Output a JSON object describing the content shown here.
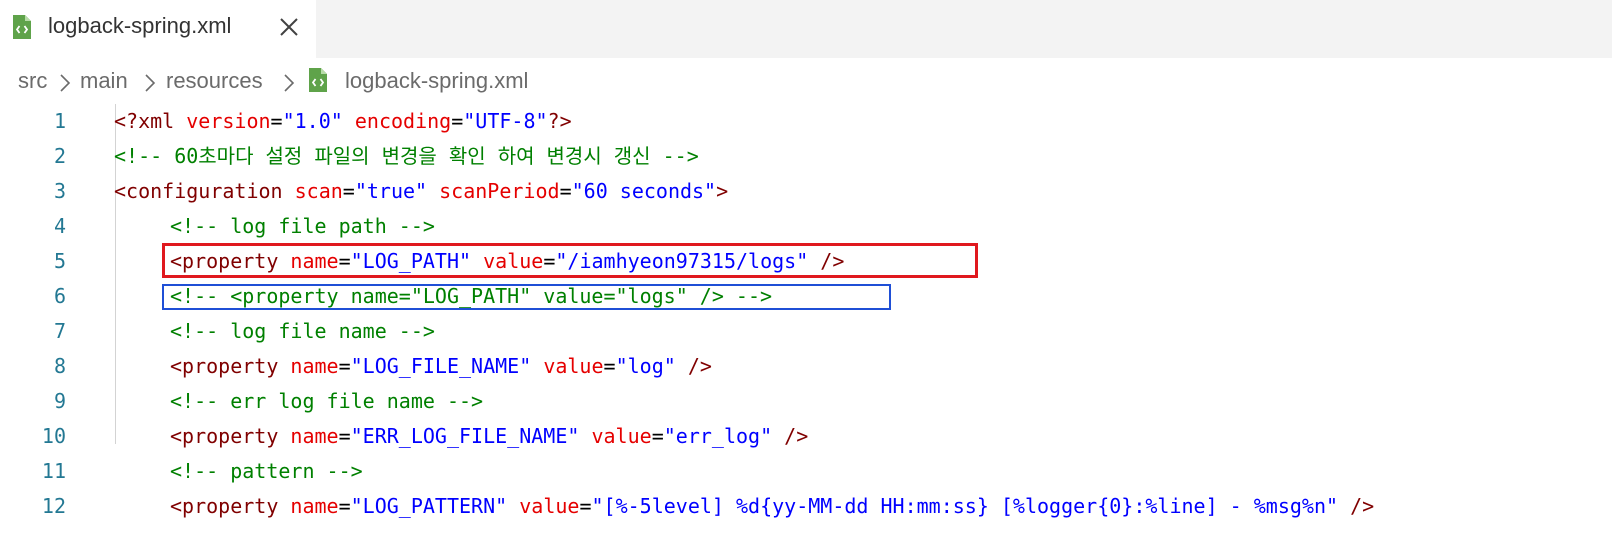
{
  "tab": {
    "label": "logback-spring.xml",
    "file_icon": "xml-file-icon",
    "close_icon": "close-icon"
  },
  "breadcrumb": {
    "items": [
      "src",
      "main",
      "resources",
      "logback-spring.xml"
    ],
    "separator": ">"
  },
  "editor": {
    "lines": [
      {
        "n": "1",
        "tokens": [
          {
            "c": "t-tag",
            "t": "<?xml "
          },
          {
            "c": "t-attr",
            "t": "version"
          },
          {
            "c": "t-eq",
            "t": "="
          },
          {
            "c": "t-val",
            "t": "\"1.0\""
          },
          {
            "c": "t-eq",
            "t": " "
          },
          {
            "c": "t-attr",
            "t": "encoding"
          },
          {
            "c": "t-eq",
            "t": "="
          },
          {
            "c": "t-val",
            "t": "\"UTF-8\""
          },
          {
            "c": "t-tag",
            "t": "?>"
          }
        ]
      },
      {
        "n": "2",
        "tokens": [
          {
            "c": "t-com",
            "t": "<!-- 60초마다 설정 파일의 변경을 확인 하여 변경시 갱신 -->"
          }
        ]
      },
      {
        "n": "3",
        "tokens": [
          {
            "c": "t-tag",
            "t": "<configuration "
          },
          {
            "c": "t-attr",
            "t": "scan"
          },
          {
            "c": "t-eq",
            "t": "="
          },
          {
            "c": "t-val",
            "t": "\"true\""
          },
          {
            "c": "t-eq",
            "t": " "
          },
          {
            "c": "t-attr",
            "t": "scanPeriod"
          },
          {
            "c": "t-eq",
            "t": "="
          },
          {
            "c": "t-val",
            "t": "\"60 seconds\""
          },
          {
            "c": "t-tag",
            "t": ">"
          }
        ]
      },
      {
        "n": "4",
        "indent": 1,
        "tokens": [
          {
            "c": "t-com",
            "t": "<!-- log file path -->"
          }
        ]
      },
      {
        "n": "5",
        "indent": 1,
        "tokens": [
          {
            "c": "t-tag",
            "t": "<property "
          },
          {
            "c": "t-attr",
            "t": "name"
          },
          {
            "c": "t-eq",
            "t": "="
          },
          {
            "c": "t-val",
            "t": "\"LOG_PATH\""
          },
          {
            "c": "t-eq",
            "t": " "
          },
          {
            "c": "t-attr",
            "t": "value"
          },
          {
            "c": "t-eq",
            "t": "="
          },
          {
            "c": "t-val",
            "t": "\"/iamhyeon97315/logs\""
          },
          {
            "c": "t-tag",
            "t": " />"
          }
        ]
      },
      {
        "n": "6",
        "indent": 1,
        "tokens": [
          {
            "c": "t-com",
            "t": "<!-- <property name=\"LOG_PATH\" value=\"logs\" /> -->"
          }
        ]
      },
      {
        "n": "7",
        "indent": 1,
        "tokens": [
          {
            "c": "t-com",
            "t": "<!-- log file name -->"
          }
        ]
      },
      {
        "n": "8",
        "indent": 1,
        "tokens": [
          {
            "c": "t-tag",
            "t": "<property "
          },
          {
            "c": "t-attr",
            "t": "name"
          },
          {
            "c": "t-eq",
            "t": "="
          },
          {
            "c": "t-val",
            "t": "\"LOG_FILE_NAME\""
          },
          {
            "c": "t-eq",
            "t": " "
          },
          {
            "c": "t-attr",
            "t": "value"
          },
          {
            "c": "t-eq",
            "t": "="
          },
          {
            "c": "t-val",
            "t": "\"log\""
          },
          {
            "c": "t-tag",
            "t": " />"
          }
        ]
      },
      {
        "n": "9",
        "indent": 1,
        "tokens": [
          {
            "c": "t-com",
            "t": "<!-- err log file name -->"
          }
        ]
      },
      {
        "n": "10",
        "indent": 1,
        "tokens": [
          {
            "c": "t-tag",
            "t": "<property "
          },
          {
            "c": "t-attr",
            "t": "name"
          },
          {
            "c": "t-eq",
            "t": "="
          },
          {
            "c": "t-val",
            "t": "\"ERR_LOG_FILE_NAME\""
          },
          {
            "c": "t-eq",
            "t": " "
          },
          {
            "c": "t-attr",
            "t": "value"
          },
          {
            "c": "t-eq",
            "t": "="
          },
          {
            "c": "t-val",
            "t": "\"err_log\""
          },
          {
            "c": "t-tag",
            "t": " />"
          }
        ]
      },
      {
        "n": "11",
        "indent": 1,
        "tokens": [
          {
            "c": "t-com",
            "t": "<!-- pattern -->"
          }
        ]
      },
      {
        "n": "12",
        "indent": 1,
        "tokens": [
          {
            "c": "t-tag",
            "t": "<property "
          },
          {
            "c": "t-attr",
            "t": "name"
          },
          {
            "c": "t-eq",
            "t": "="
          },
          {
            "c": "t-val",
            "t": "\"LOG_PATTERN\""
          },
          {
            "c": "t-eq",
            "t": " "
          },
          {
            "c": "t-attr",
            "t": "value"
          },
          {
            "c": "t-eq",
            "t": "="
          },
          {
            "c": "t-val",
            "t": "\"[%-5level] %d{yy-MM-dd HH:mm:ss} [%logger{0}:%line] - %msg%n\""
          },
          {
            "c": "t-tag",
            "t": " />"
          }
        ]
      }
    ]
  },
  "highlights": [
    {
      "line": "5",
      "color": "#e0181e"
    },
    {
      "line": "6",
      "color": "#1f4fd6"
    }
  ],
  "colors": {
    "tag": "#800000",
    "attribute": "#e50000",
    "value": "#0000ff",
    "comment": "#008000",
    "line_number": "#237893"
  }
}
